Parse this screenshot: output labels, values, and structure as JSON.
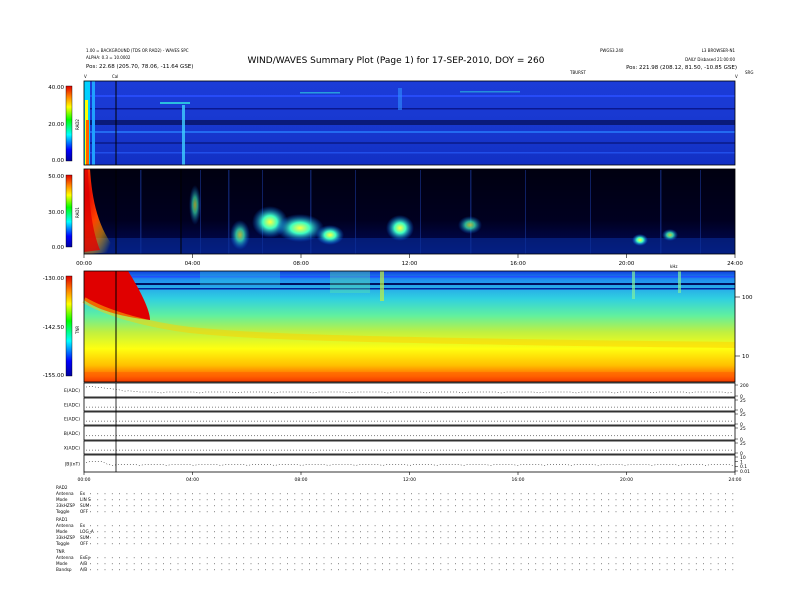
{
  "header": {
    "title": "WIND/WAVES Summary Plot (Page 1) for 17-SEP-2010, DOY = 260",
    "left_line1": "1.00 = BACKGROUND (TDS OR RAD2) - WAVES SPC",
    "left_line2": "ALPHA: 0.3 = 10.0002",
    "pos_start": "Pos:   22.68 (205.70, 78.06, -11.64 GSE)",
    "right_line1": "PWGS3.240",
    "right_line2": "L3 BROWSER-N1",
    "right_line3": "DAILY  Disbased 21:00:00",
    "pos_end": "Pos:   221.98 (208.12, 81.50, -10.85 GSE)",
    "mark_left": "V",
    "mark_cal": "Cal",
    "mark_right": "V",
    "mark_tbursts": "TBURST",
    "mark_srg": "SRG"
  },
  "chart_data": [
    {
      "type": "heatmap",
      "panel": "RAD2",
      "ylabel": "RAD2",
      "colorbar_ticks": [
        "40.00",
        "20.00",
        "0.00"
      ],
      "ylim": [
        0,
        40
      ],
      "features": [
        {
          "kind": "type-III-burst",
          "time_hours": 0.4
        },
        {
          "kind": "vertical-line",
          "time_hours": 1.25
        },
        {
          "kind": "burst",
          "time_hours": 3.75
        },
        {
          "kind": "burst",
          "time_hours": 10.0
        }
      ]
    },
    {
      "type": "heatmap",
      "panel": "RAD1",
      "ylabel": "RAD1",
      "colorbar_ticks": [
        "50.00",
        "30.00",
        "0.00"
      ],
      "ylim": [
        0,
        50
      ],
      "x_ticks": [
        "00:00",
        "04:00",
        "08:00",
        "12:00",
        "16:00",
        "20:00",
        "24:00"
      ],
      "features": [
        {
          "kind": "type-III-burst",
          "time_hours": 0.3
        },
        {
          "kind": "vertical-line",
          "time_hours": 1.25
        },
        {
          "kind": "vertical-line",
          "time_hours": 3.6
        },
        {
          "kind": "bright-blob",
          "time_hours": 6.5
        },
        {
          "kind": "bright-blob",
          "time_hours": 8.0
        },
        {
          "kind": "bright-blob",
          "time_hours": 10.8
        },
        {
          "kind": "bright-blob",
          "time_hours": 21.5
        }
      ]
    },
    {
      "type": "heatmap",
      "panel": "TNR",
      "ylabel": "TNR",
      "colorbar_ticks": [
        "-130.00",
        "-142.50",
        "-155.00"
      ],
      "ylim": [
        -155,
        -130
      ],
      "right_axis_label": "kHz",
      "right_ticks": [
        "100",
        "10"
      ],
      "features": [
        {
          "kind": "intense-burst",
          "time_hours": 0.7
        },
        {
          "kind": "vertical-line",
          "time_hours": 1.25
        }
      ]
    },
    {
      "type": "line",
      "panel": "housekeeping",
      "rows": [
        {
          "label": "E(ADC)",
          "right_ticks": [
            "200",
            "0"
          ]
        },
        {
          "label": "E(ADC)",
          "right_ticks": [
            "25",
            "0"
          ]
        },
        {
          "label": "E(ADC)",
          "right_ticks": [
            "25",
            "0"
          ]
        },
        {
          "label": "B(ADC)",
          "right_ticks": [
            "25",
            "0"
          ]
        },
        {
          "label": "X(ADC)",
          "right_ticks": [
            "25",
            "0"
          ]
        },
        {
          "label": "|B|(nT)",
          "right_ticks": [
            "10",
            "1",
            "0.1",
            "0.01"
          ]
        }
      ],
      "x_ticks": [
        "00:00",
        "04:00",
        "08:00",
        "12:00",
        "16:00",
        "20:00",
        "24:00"
      ]
    }
  ],
  "modes": {
    "rad2": [
      {
        "k": "RAD2",
        "v": ""
      },
      {
        "k": "Antenna",
        "v": "Ex"
      },
      {
        "k": "Mode",
        "v": "LIN S"
      },
      {
        "k": "33kHZSP",
        "v": "SUM"
      },
      {
        "k": "Toggle",
        "v": "OFF"
      }
    ],
    "rad1": [
      {
        "k": "RAD1",
        "v": ""
      },
      {
        "k": "Antenna",
        "v": "Ex"
      },
      {
        "k": "Mode",
        "v": "LOG_A"
      },
      {
        "k": "33kHZSP",
        "v": "SUM"
      },
      {
        "k": "Toggle",
        "v": "OFF"
      }
    ],
    "tnr": [
      {
        "k": "TNR",
        "v": ""
      },
      {
        "k": "Antenna",
        "v": "ExEy"
      },
      {
        "k": "Mode",
        "v": "A/B"
      },
      {
        "k": "Bandsp",
        "v": "A/B"
      }
    ]
  }
}
